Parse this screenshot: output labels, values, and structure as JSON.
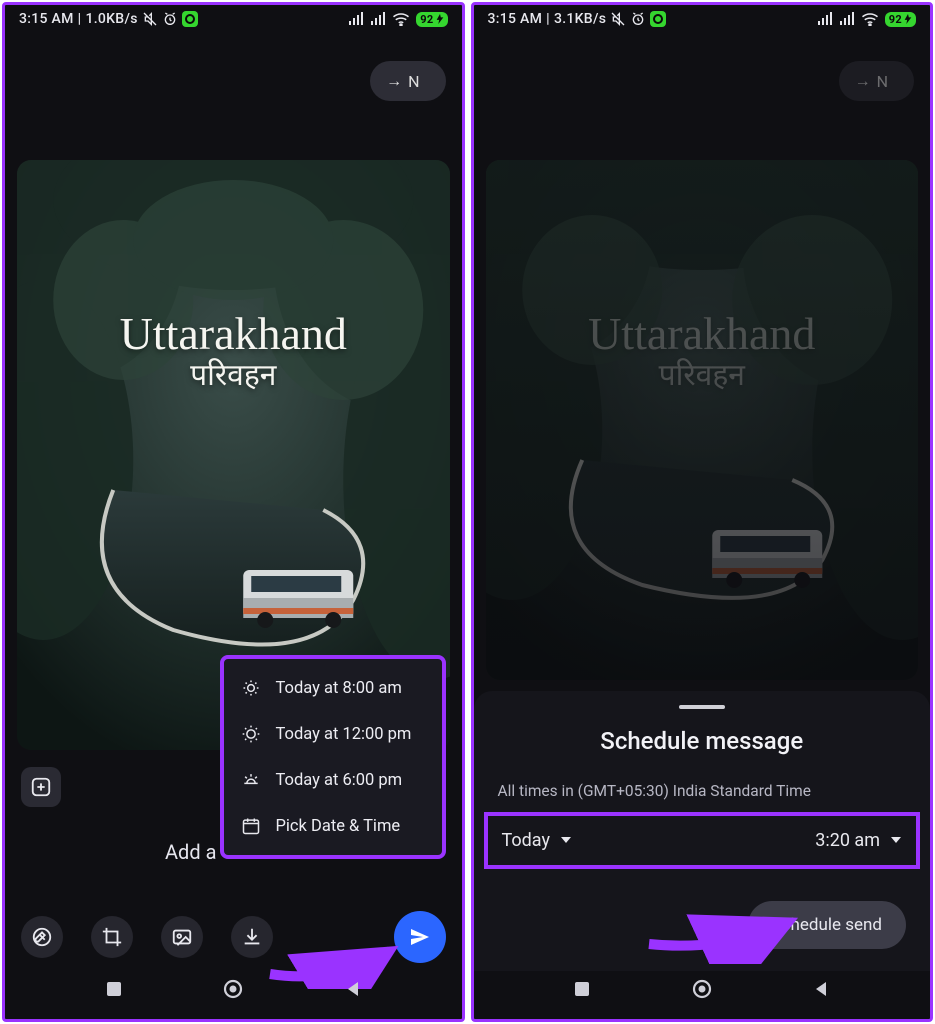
{
  "left": {
    "status": {
      "time": "3:15 AM",
      "net": "1.0KB/s",
      "battery": "92"
    },
    "recipient_pill": {
      "arrow": "→",
      "initial": "N"
    },
    "image_overlay": {
      "title": "Uttarakhand",
      "subtitle": "परिवहन"
    },
    "caption_placeholder": "Add a",
    "schedule_menu": {
      "items": [
        {
          "icon": "sunrise",
          "label": "Today at 8:00 am"
        },
        {
          "icon": "sun",
          "label": "Today at 12:00 pm"
        },
        {
          "icon": "sunset",
          "label": "Today at 6:00 pm"
        },
        {
          "icon": "calendar",
          "label": "Pick Date & Time"
        }
      ]
    }
  },
  "right": {
    "status": {
      "time": "3:15 AM",
      "net": "3.1KB/s",
      "battery": "92"
    },
    "recipient_pill": {
      "arrow": "→",
      "initial": "N"
    },
    "image_overlay": {
      "title": "Uttarakhand",
      "subtitle": "परिवहन"
    },
    "sheet": {
      "title": "Schedule message",
      "tz_note": "All times in (GMT+05:30) India Standard Time",
      "date_label": "Today",
      "time_label": "3:20 am",
      "send_label": "Schedule send"
    }
  }
}
